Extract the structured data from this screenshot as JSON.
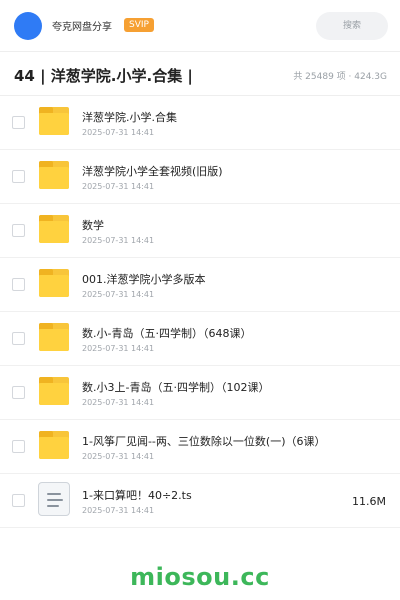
{
  "header": {
    "username": "夸克网盘分享",
    "badge": "SVIP",
    "search_placeholder": "搜索",
    "avatar_color": "#2f7bf5",
    "badge_color": "#f6a032"
  },
  "folder": {
    "title": "44 | 洋葱学院.小学.合集 |",
    "stats": "共 25489 项 · 424.3G"
  },
  "items": [
    {
      "name": "洋葱学院.小学.合集",
      "date": "2025-07-31 14:41",
      "type": "folder",
      "size": ""
    },
    {
      "name": "洋葱学院小学全套视频(旧版)",
      "date": "2025-07-31 14:41",
      "type": "folder",
      "size": ""
    },
    {
      "name": "数学",
      "date": "2025-07-31 14:41",
      "type": "folder",
      "size": ""
    },
    {
      "name": "001.洋葱学院小学多版本",
      "date": "2025-07-31 14:41",
      "type": "folder",
      "size": ""
    },
    {
      "name": "数.小-青岛（五·四学制）（648课）",
      "date": "2025-07-31 14:41",
      "type": "folder",
      "size": ""
    },
    {
      "name": "数.小3上-青岛（五·四学制）（102课）",
      "date": "2025-07-31 14:41",
      "type": "folder",
      "size": ""
    },
    {
      "name": "1-风筝厂见闻--两、三位数除以一位数(一)（6课）",
      "date": "2025-07-31 14:41",
      "type": "folder",
      "size": ""
    },
    {
      "name": "1-来口算吧！40÷2.ts",
      "date": "2025-07-31 14:41",
      "type": "file",
      "size": "11.6M"
    }
  ],
  "footer": {
    "brand": "miosou.cc",
    "brand_color": "#3db75a"
  }
}
